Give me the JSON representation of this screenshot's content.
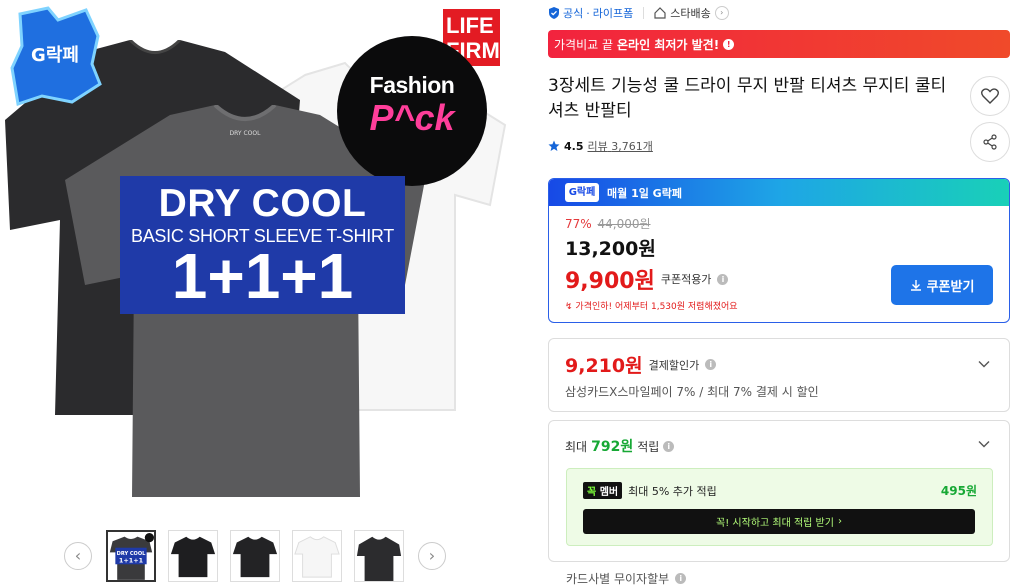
{
  "hero": {
    "badge_text": "G락페",
    "life_text": "LIFE\nFIRM",
    "fashion_line1": "Fashion",
    "fashion_line2": "P^ck",
    "promo_line1": "DRY COOL",
    "promo_line2": "BASIC SHORT SLEEVE T-SHIRT",
    "promo_line3": "1+1+1",
    "shirt_label": "DRY COOL"
  },
  "thumbs": {
    "prev_icon": "chevron-left-icon",
    "next_icon": "chevron-right-icon",
    "thumb1_line1": "DRY COOL",
    "thumb1_line2": "1+1+1"
  },
  "store": {
    "official_label": "공식",
    "store_name": "라이프폼",
    "delivery_label": "스타배송"
  },
  "banner": {
    "text_pre": "가격비교 끝",
    "text_bold": "온라인 최저가 발견!",
    "icon": "info-icon",
    "color": "#f2233e"
  },
  "product": {
    "title": "3장세트 기능성 쿨 드라이 무지 반팔 티셔츠 무지티 쿨티셔츠 반팔티",
    "rating": "4.5",
    "review_label": "리뷰",
    "review_count": "3,761개"
  },
  "coupon": {
    "header_badge": "G락페",
    "header_text": "매월 1일 G락페",
    "discount_rate": "77%",
    "original_price": "44,000원",
    "sale_price": "13,200원",
    "coupon_price": "9,900원",
    "coupon_label": "쿠폰적용가",
    "price_drop_note": "가격인하! 어제부터 1,530원 저렴해졌어요",
    "button_label": "쿠폰받기",
    "accent": "#1e74e8"
  },
  "payment": {
    "amount": "9,210원",
    "amount_label": "결제할인가",
    "desc": "삼성카드X스마일페이 7% / 최대 7% 결제 시 할인"
  },
  "points": {
    "prefix": "최대",
    "amount": "792원",
    "suffix": "적립",
    "member_badge_a": "꼭",
    "member_badge_b": "멤버",
    "member_text": "최대 5% 추가 적립",
    "member_amount": "495원",
    "member_button": "꼭! 시작하고 최대 적립 받기",
    "accent": "#17a835"
  },
  "bottom": {
    "text": "카드사별 무이자할부"
  }
}
